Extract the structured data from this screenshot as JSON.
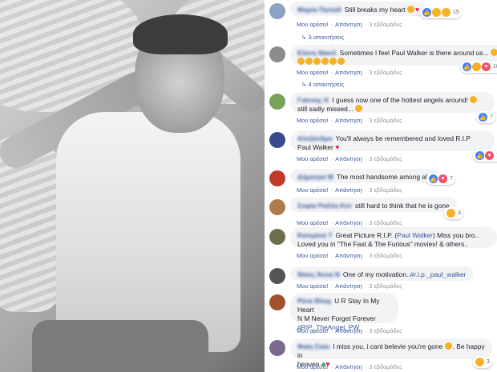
{
  "comments": [
    {
      "author": "Μαρία Παπαδ",
      "text": "Still breaks my heart",
      "suffix": "",
      "count": "15",
      "action_like": "Μου αρέσει!",
      "action_reply": "Απάντηση",
      "time": "3 εβδομάδες",
      "replies": "3 απαντήσεις",
      "avatar_color": "#8da2c0"
    },
    {
      "author": "Ελένη Νικολ",
      "text": "Sometimes I feel Paul Walker is there around us...",
      "suffix": "",
      "count": "18",
      "action_like": "Μου αρέσει!",
      "action_reply": "Απάντηση",
      "time": "3 εβδομάδες",
      "replies": "4 απαντήσεις",
      "avatar_color": "#8c8c8c"
    },
    {
      "author": "Γιάννης Κ",
      "text": "I guess now one of the hottest angels around!",
      "suffix": "still sadly missed...",
      "count": "7",
      "action_like": "Μου αρέσει!",
      "action_reply": "Απάντηση",
      "time": "3 εβδομάδες",
      "avatar_color": "#7aa05a"
    },
    {
      "author": "Αλεξάνδρα",
      "text": "You'll always be remembered and loved R.I.P",
      "suffix": "Paul Walker",
      "count": "7",
      "action_like": "Μου αρέσει!",
      "action_reply": "Απάντηση",
      "time": "3 εβδομάδες",
      "avatar_color": "#3a4a8c"
    },
    {
      "author": "Δήμητρα Μ",
      "text": "The most handsome among all !",
      "suffix": "",
      "count": "7",
      "action_like": "Μου αρέσει!",
      "action_reply": "Απάντηση",
      "time": "3 εβδομάδες",
      "avatar_color": "#c0392b"
    },
    {
      "author": "Σοφία Ραλλη Κοτ",
      "text": "still hard to think that he is gone",
      "suffix": "",
      "count": "3",
      "action_like": "Μου αρέσει!",
      "action_reply": "Απάντηση",
      "time": "3 εβδομάδες",
      "avatar_color": "#b07a4a"
    },
    {
      "author": "Κατερίνα Τ",
      "text_prefix": "Great Picture R.I.P. (",
      "mention": "Paul Walker",
      "text_suffix": ") Miss you bro..",
      "line2": "Loved you in \"The Fast & The Furious\" movies! & others..",
      "action_like": "Μου αρέσει!",
      "action_reply": "Απάντηση",
      "time": "3 εβδομάδες",
      "avatar_color": "#6e6e4a"
    },
    {
      "author": "Νίκος Άννα Ν",
      "text": "One of my motivation..",
      "hashtag": "#r.i.p._paul_walker",
      "action_like": "Μου αρέσει!",
      "action_reply": "Απάντηση",
      "time": "3 εβδομάδες",
      "avatar_color": "#555555"
    },
    {
      "author": "Ρένα Βλαχ",
      "text": "U R Stay In My Heart",
      "line2": "N M Never Forget Forever",
      "hashtag": "#RIP_TheAngel_PW",
      "action_like": "Μου αρέσει!",
      "action_reply": "Απάντηση",
      "time": "3 εβδομάδες",
      "avatar_color": "#a0522d"
    },
    {
      "author": "Φαίη Σταυ",
      "text": "I miss you, i cant belevie you're gone",
      "suffix": ". Be happy in",
      "line2": "heaven",
      "count": "3",
      "action_like": "Μου αρέσει!",
      "action_reply": "Απάντηση",
      "time": "3 εβδομάδες",
      "avatar_color": "#7b6a8c"
    }
  ]
}
